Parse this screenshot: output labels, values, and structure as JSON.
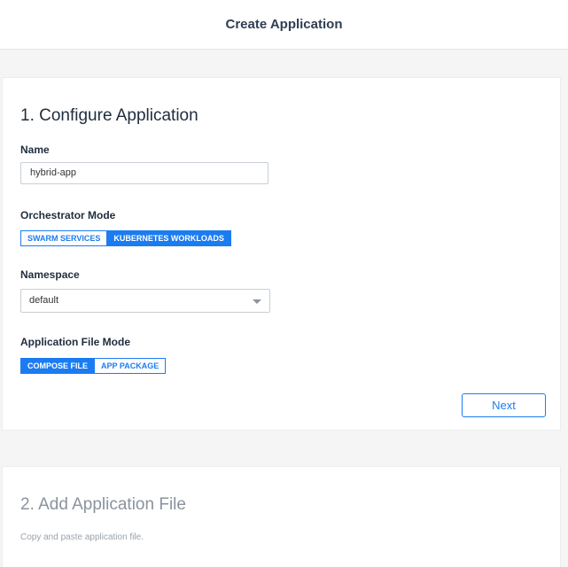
{
  "header": {
    "title": "Create Application"
  },
  "step1": {
    "title": "1. Configure Application",
    "name": {
      "label": "Name",
      "value": "hybrid-app"
    },
    "orchestrator": {
      "label": "Orchestrator Mode",
      "options": [
        "SWARM SERVICES",
        "KUBERNETES WORKLOADS"
      ],
      "selected": "KUBERNETES WORKLOADS"
    },
    "namespace": {
      "label": "Namespace",
      "value": "default"
    },
    "file_mode": {
      "label": "Application File Mode",
      "options": [
        "COMPOSE FILE",
        "APP PACKAGE"
      ],
      "selected": "COMPOSE FILE"
    },
    "next_label": "Next"
  },
  "step2": {
    "title": "2. Add Application File",
    "help": "Copy and paste application file."
  },
  "colors": {
    "accent": "#1b7cf2",
    "muted": "#8a939d"
  },
  "icons": {
    "dropdown": "chevron-down-icon"
  }
}
